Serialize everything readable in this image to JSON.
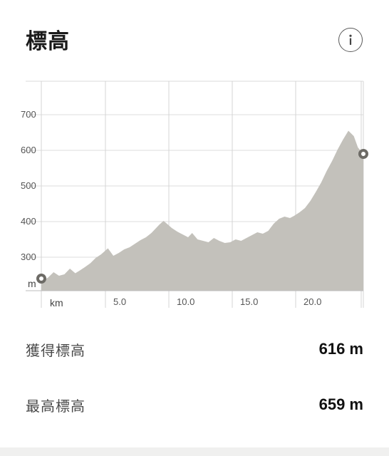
{
  "header": {
    "title": "標高",
    "info_icon": "info-icon"
  },
  "chart_data": {
    "type": "area",
    "title": "標高",
    "xlabel": "km",
    "ylabel": "m",
    "xlim": [
      0,
      23.7
    ],
    "ylim": [
      200,
      800
    ],
    "x_ticks": [
      "5.0",
      "10.0",
      "15.0",
      "20.0"
    ],
    "y_ticks": [
      "700",
      "600",
      "500",
      "400",
      "300"
    ],
    "grid": true,
    "fill_color": "#c3c1bb",
    "x": [
      0,
      0.5,
      0.9,
      1.3,
      1.7,
      2.1,
      2.5,
      2.8,
      3.2,
      3.6,
      4.0,
      4.4,
      4.9,
      5.3,
      5.7,
      6.1,
      6.5,
      6.9,
      7.3,
      7.7,
      8.1,
      8.4,
      8.7,
      9.0,
      9.3,
      9.6,
      10.0,
      10.4,
      10.8,
      11.1,
      11.5,
      11.9,
      12.3,
      12.7,
      13.1,
      13.5,
      13.9,
      14.3,
      14.7,
      15.1,
      15.5,
      15.9,
      16.3,
      16.7,
      17.1,
      17.5,
      17.9,
      18.3,
      18.6,
      19.0,
      19.4,
      19.8,
      20.2,
      20.6,
      21.0,
      21.4,
      21.8,
      22.2,
      22.6,
      23.0,
      23.3,
      23.7
    ],
    "values": [
      232,
      243,
      258,
      248,
      252,
      268,
      255,
      262,
      272,
      283,
      298,
      308,
      325,
      304,
      312,
      322,
      328,
      338,
      348,
      356,
      368,
      380,
      392,
      402,
      392,
      382,
      372,
      364,
      356,
      368,
      350,
      346,
      342,
      354,
      346,
      340,
      342,
      350,
      346,
      354,
      362,
      370,
      366,
      374,
      394,
      408,
      414,
      410,
      416,
      426,
      438,
      458,
      483,
      510,
      542,
      570,
      602,
      630,
      655,
      640,
      608,
      590
    ],
    "markers": [
      {
        "x": 0,
        "y": 240
      },
      {
        "x": 23.7,
        "y": 590
      }
    ]
  },
  "stats": [
    {
      "label": "獲得標高",
      "value": "616 m"
    },
    {
      "label": "最高標高",
      "value": "659 m"
    }
  ]
}
